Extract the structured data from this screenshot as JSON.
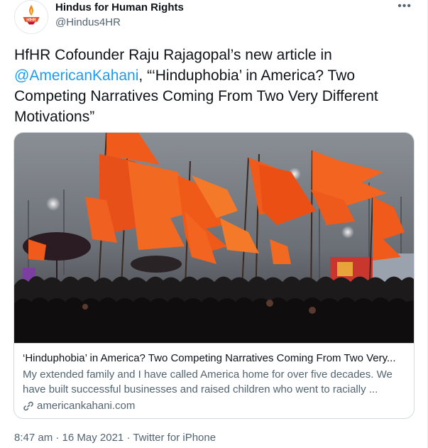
{
  "author": {
    "name": "Hindus for Human Rights",
    "handle": "@Hindus4HR",
    "avatar_text": "HfHR"
  },
  "more_label": "•••",
  "tweet": {
    "text_before": "HfHR Cofounder Raju Rajagopal’s new article in ",
    "mention": "@AmericanKahani",
    "text_after": ", “‘Hinduphobia’ in America? Two Competing Narratives Coming From Two Very Different Motivations”"
  },
  "card": {
    "image_alt": "crowd with orange flags",
    "title": "‘Hinduphobia’ in America? Two Competing Narratives Coming From Two Very...",
    "description_line1": "My extended family and I have called America home for over five decades. We",
    "description_line2": "have built successful businesses and raised children who went to racially ...",
    "domain": "americankahani.com"
  },
  "footer": {
    "time": "8:47 am",
    "separator1": " · ",
    "date": "16 May 2021",
    "separator2": " · ",
    "source": "Twitter for iPhone"
  },
  "colors": {
    "accent": "#1d9bf0",
    "secondary_text": "#536471",
    "flag_orange": "#f05a1a"
  }
}
